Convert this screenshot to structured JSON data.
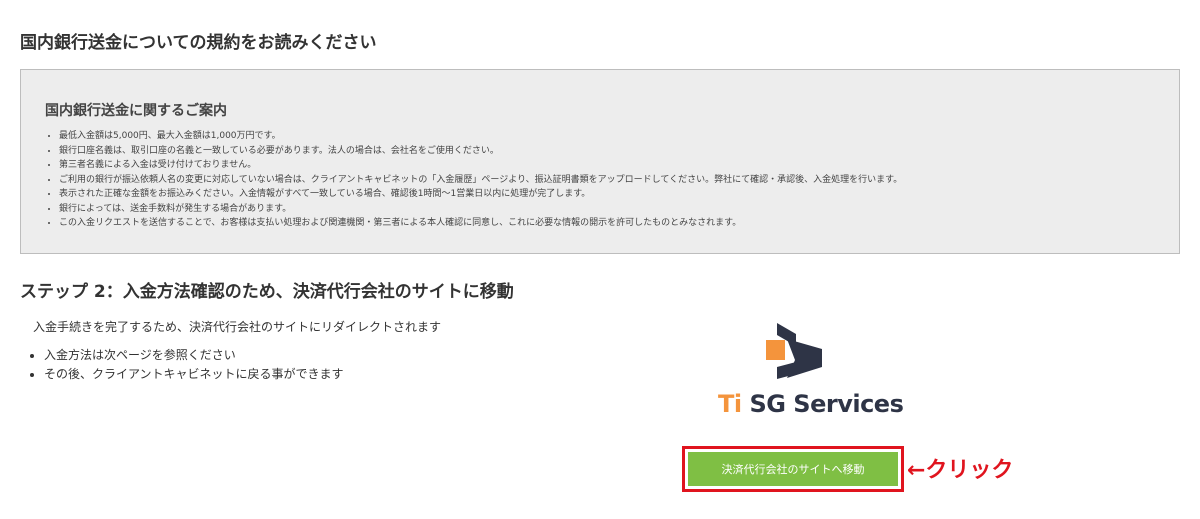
{
  "page_title": "国内銀行送金についての規約をお読みください",
  "notice": {
    "title": "国内銀行送金に関するご案内",
    "items": [
      "最低入金額は5,000円、最大入金額は1,000万円です。",
      "銀行口座名義は、取引口座の名義と一致している必要があります。法人の場合は、会社名をご使用ください。",
      "第三者名義による入金は受け付けておりません。",
      "ご利用の銀行が振込依頼人名の変更に対応していない場合は、クライアントキャビネットの「入金履歴」ページより、振込証明書類をアップロードしてください。弊社にて確認・承認後、入金処理を行います。",
      "表示された正確な金額をお振込みください。入金情報がすべて一致している場合、確認後1時間〜1営業日以内に処理が完了します。",
      "銀行によっては、送金手数料が発生する場合があります。",
      "この入金リクエストを送信することで、お客様は支払い処理および関連機関・第三者による本人確認に同意し、これに必要な情報の開示を許可したものとみなされます。"
    ]
  },
  "step": {
    "title": "ステップ 2：入金方法確認のため、決済代行会社のサイトに移動",
    "description": "入金手続きを完了するため、決済代行会社のサイトにリダイレクトされます",
    "items": [
      "入金方法は次ページを参照ください",
      "その後、クライアントキャビネットに戻る事ができます"
    ]
  },
  "logo": {
    "accent_text": "Ti",
    "main_text": " SG Services",
    "icon": "tisg-logo-icon",
    "colors": {
      "orange": "#f4943c",
      "navy": "#2e3446"
    }
  },
  "button": {
    "label": "決済代行会社のサイトへ移動",
    "color": "#7fbf44"
  },
  "annotation": {
    "text": "←クリック",
    "color": "#e0141e"
  }
}
